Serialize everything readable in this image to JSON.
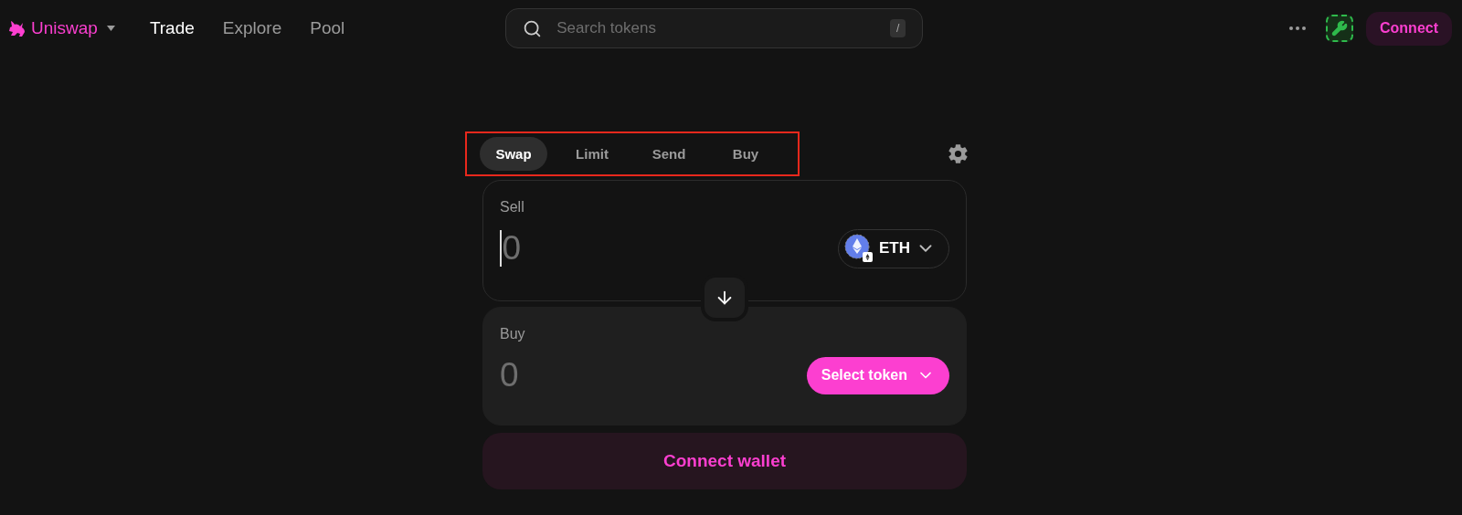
{
  "header": {
    "logo": {
      "text": "Uniswap"
    },
    "nav": [
      {
        "label": "Trade",
        "selected": true
      },
      {
        "label": "Explore",
        "selected": false
      },
      {
        "label": "Pool",
        "selected": false
      }
    ],
    "search": {
      "placeholder": "Search tokens",
      "shortcut": "/"
    },
    "connect_button": "Connect"
  },
  "swap": {
    "tabs_highlighted": true,
    "tabs": [
      {
        "label": "Swap",
        "selected": true
      },
      {
        "label": "Limit",
        "selected": false
      },
      {
        "label": "Send",
        "selected": false
      },
      {
        "label": "Buy",
        "selected": false
      }
    ],
    "sell": {
      "label": "Sell",
      "placeholder": "0",
      "focused": true,
      "token": {
        "kind": "token",
        "symbol": "ETH"
      }
    },
    "buy": {
      "label": "Buy",
      "placeholder": "0",
      "focused": false,
      "token": {
        "kind": "select",
        "label": "Select token"
      }
    },
    "connect_wallet": "Connect wallet"
  }
}
